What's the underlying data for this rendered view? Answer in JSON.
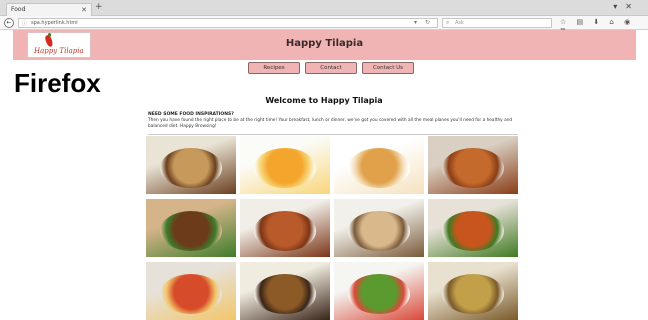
{
  "browser": {
    "tab_title": "Food",
    "url": "spa.hyperlink.html",
    "search_placeholder": "Ask"
  },
  "site": {
    "logo_text": "Happy Tilapia",
    "title": "Happy Tilapia",
    "menu": [
      "Recipes",
      "Contact",
      "Contact Us"
    ]
  },
  "browser_label": "Firefox",
  "main": {
    "welcome": "Welcome to Happy Tilapia",
    "intro_heading": "NEED SOME FOOD INSPIRATIONS?",
    "intro_text": "Then you have found the right place to be at the right time! Your breakfast, lunch or dinner, we've got you covered with all the meal planes you'll need for a healthy and balanced diet. Happy Browsing!"
  },
  "images": [
    {
      "name": "curry-bowl-image",
      "colors": [
        "#c79a5c",
        "#6b3f1e",
        "#e9e4d6"
      ]
    },
    {
      "name": "mango-juice-image",
      "colors": [
        "#f4a52b",
        "#f8d67a",
        "#fbfbf7"
      ]
    },
    {
      "name": "pancakes-image",
      "colors": [
        "#e0a14a",
        "#f5e2bf",
        "#ffffff"
      ]
    },
    {
      "name": "chicken-stew-image",
      "colors": [
        "#c46a2c",
        "#8a3d17",
        "#d9d0c3"
      ]
    },
    {
      "name": "beef-salad-image",
      "colors": [
        "#6b3b1a",
        "#3e7d2b",
        "#d5b48a"
      ]
    },
    {
      "name": "chicken-pieces-image",
      "colors": [
        "#b85a2a",
        "#7b3516",
        "#f1eee8"
      ]
    },
    {
      "name": "wraps-image",
      "colors": [
        "#d9b98c",
        "#7a5a3a",
        "#f2f0ea"
      ]
    },
    {
      "name": "stir-fry-image",
      "colors": [
        "#c8551d",
        "#3f7a22",
        "#e7e1d8"
      ]
    },
    {
      "name": "pizza-image",
      "colors": [
        "#d64b2a",
        "#f2c66a",
        "#e6e2da"
      ]
    },
    {
      "name": "meatballs-image",
      "colors": [
        "#8c5a26",
        "#3a2418",
        "#f1ece0"
      ]
    },
    {
      "name": "green-salad-image",
      "colors": [
        "#5b9a2e",
        "#d94a3a",
        "#f5f5f2"
      ]
    },
    {
      "name": "casserole-image",
      "colors": [
        "#c2a04a",
        "#7a5a2a",
        "#e9e1cf"
      ]
    }
  ]
}
